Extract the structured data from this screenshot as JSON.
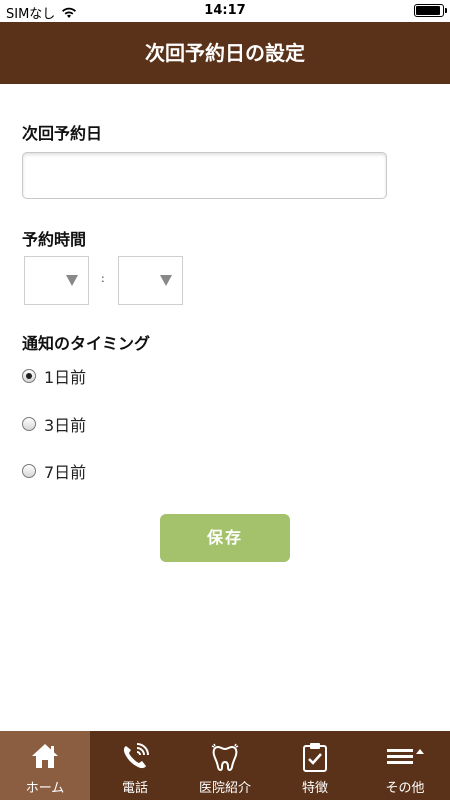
{
  "status_bar": {
    "carrier": "SIMなし",
    "time": "14:17"
  },
  "header": {
    "title": "次回予約日の設定"
  },
  "form": {
    "next_date_label": "次回予約日",
    "next_date_value": "",
    "time_label": "予約時間",
    "hour_value": "",
    "minute_value": "",
    "time_separator": ":",
    "notify_label": "通知のタイミング",
    "notify_options": [
      {
        "label": "1日前",
        "checked": true
      },
      {
        "label": "3日前",
        "checked": false
      },
      {
        "label": "7日前",
        "checked": false
      }
    ],
    "save_label": "保存"
  },
  "tabbar": {
    "items": [
      {
        "label": "ホーム",
        "icon": "home-icon",
        "active": true
      },
      {
        "label": "電話",
        "icon": "phone-icon",
        "active": false
      },
      {
        "label": "医院紹介",
        "icon": "tooth-icon",
        "active": false
      },
      {
        "label": "特徴",
        "icon": "clipboard-check-icon",
        "active": false
      },
      {
        "label": "その他",
        "icon": "menu-icon",
        "active": false
      }
    ]
  },
  "colors": {
    "brand_brown": "#5a3219",
    "active_tab": "#8b5e42",
    "save_green": "#a3c26b"
  }
}
